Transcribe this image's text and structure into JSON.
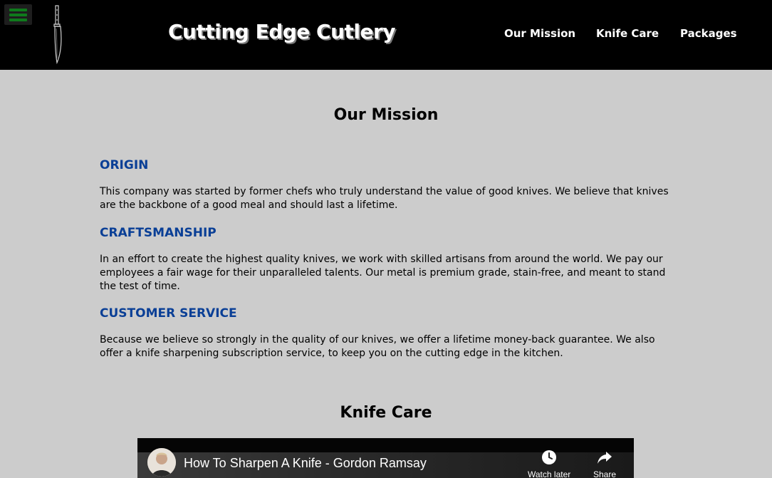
{
  "header": {
    "brand": "Cutting Edge Cutlery",
    "menu_icon": "hamburger-menu-icon",
    "logo_icon": "chef-knife-icon",
    "accent_color": "#0f7a1c",
    "nav": [
      {
        "label": "Our Mission"
      },
      {
        "label": "Knife Care"
      },
      {
        "label": "Packages"
      }
    ]
  },
  "mission": {
    "title": "Our Mission",
    "sections": [
      {
        "heading": "ORIGIN",
        "text": "This company was started by former chefs who truly understand the value of good knives. We believe that knives are the backbone of a good meal and should last a lifetime."
      },
      {
        "heading": "CRAFTSMANSHIP",
        "text": "In an effort to create the highest quality knives, we work with skilled artisans from around the world. We pay our employees a fair wage for their unparalleled talents. Our metal is premium grade, stain-free, and meant to stand the test of time."
      },
      {
        "heading": "CUSTOMER SERVICE",
        "text": "Because we believe so strongly in the quality of our knives, we offer a lifetime money-back guarantee. We also offer a knife sharpening subscription service, to keep you on the cutting edge in the kitchen."
      }
    ],
    "heading_color": "#0a3f96"
  },
  "knife_care": {
    "title": "Knife Care",
    "video": {
      "title": "How To Sharpen A Knife - Gordon Ramsay",
      "watch_later_label": "Watch later",
      "watch_later_icon": "clock-icon",
      "share_label": "Share",
      "share_icon": "share-arrow-icon"
    }
  }
}
